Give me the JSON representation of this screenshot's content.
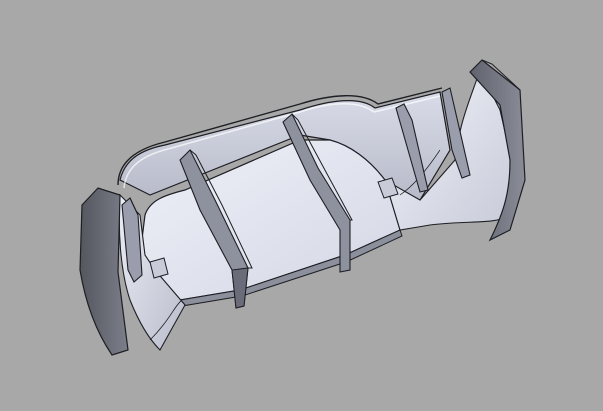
{
  "viewport": {
    "background_color": "#a8a8a8"
  },
  "model": {
    "face_light": "#e6e8f2",
    "face_mid": "#c9ccd8",
    "face_shade": "#8c8f9c",
    "face_dark": "#5f6270",
    "edge_color": "#1e1f24"
  }
}
